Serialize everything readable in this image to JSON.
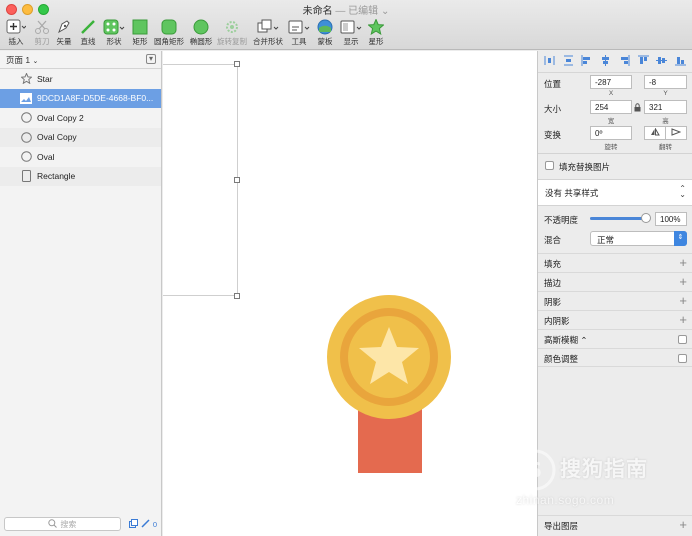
{
  "window": {
    "title": "未命名",
    "status": "— 已编辑",
    "caret": "⌄"
  },
  "toolbar": {
    "items": [
      {
        "label": "插入",
        "icon": "plus-icon"
      },
      {
        "label": "剪刀",
        "icon": "scissors-icon",
        "disabled": true
      },
      {
        "label": "矢量",
        "icon": "pen-icon"
      },
      {
        "label": "直线",
        "icon": "line-icon"
      },
      {
        "label": "形状",
        "icon": "shapes-icon"
      },
      {
        "label": "矩形",
        "icon": "rectangle-icon"
      },
      {
        "label": "圆角矩形",
        "icon": "rounded-rect-icon"
      },
      {
        "label": "椭圆形",
        "icon": "oval-icon"
      },
      {
        "label": "旋转复制",
        "icon": "rotate-copy-icon",
        "disabled": true
      },
      {
        "label": "合并形状",
        "icon": "combine-icon"
      },
      {
        "label": "工具",
        "icon": "tools-icon"
      },
      {
        "label": "蒙板",
        "icon": "mask-icon"
      },
      {
        "label": "显示",
        "icon": "view-icon"
      },
      {
        "label": "星形",
        "icon": "star-icon"
      }
    ]
  },
  "layers_panel": {
    "page_label": "页面 1",
    "layers": [
      {
        "name": "Star",
        "icon": "star-outline-icon"
      },
      {
        "name": "9DCD1A8F-D5DE-4668-BF0...",
        "icon": "image-icon",
        "selected": true
      },
      {
        "name": "Oval Copy 2",
        "icon": "circle-outline-icon"
      },
      {
        "name": "Oval Copy",
        "icon": "circle-outline-icon"
      },
      {
        "name": "Oval",
        "icon": "circle-outline-icon"
      },
      {
        "name": "Rectangle",
        "icon": "rectangle-outline-icon"
      }
    ],
    "search_placeholder": "搜索",
    "footer_count": "0"
  },
  "inspector": {
    "position_label": "位置",
    "x_value": "-287",
    "y_value": "-8",
    "x_sub": "X",
    "y_sub": "Y",
    "size_label": "大小",
    "w_value": "254",
    "h_value": "321",
    "w_sub": "宽",
    "h_sub": "高",
    "transform_label": "变换",
    "rotate_value": "0º",
    "rotate_sub": "旋转",
    "flip_sub": "翻转",
    "fill_replace_label": "填充替换图片",
    "shared_style": "没有 共享样式",
    "opacity_label": "不透明度",
    "opacity_value": "100%",
    "opacity_fraction": 1.0,
    "blend_label": "混合",
    "blend_value": "正常",
    "sections": [
      {
        "label": "填充",
        "action": "plus"
      },
      {
        "label": "描边",
        "action": "plus"
      },
      {
        "label": "阴影",
        "action": "plus"
      },
      {
        "label": "内阴影",
        "action": "plus"
      },
      {
        "label": "高斯模糊 ⌃",
        "action": "check"
      },
      {
        "label": "颜色调整",
        "action": "check"
      }
    ],
    "export_label": "导出图层"
  },
  "colors": {
    "selection": "#6c9fe4",
    "medal_outer": "#f0c04a",
    "medal_ring": "#e9a53c",
    "medal_inner": "#f0c04a",
    "medal_star": "#fde6a8",
    "ribbon": "#e46a4f",
    "accent_green": "#3bb33b"
  },
  "watermark": {
    "text": "搜狗指南",
    "url": "zhinan.sogo.com"
  }
}
